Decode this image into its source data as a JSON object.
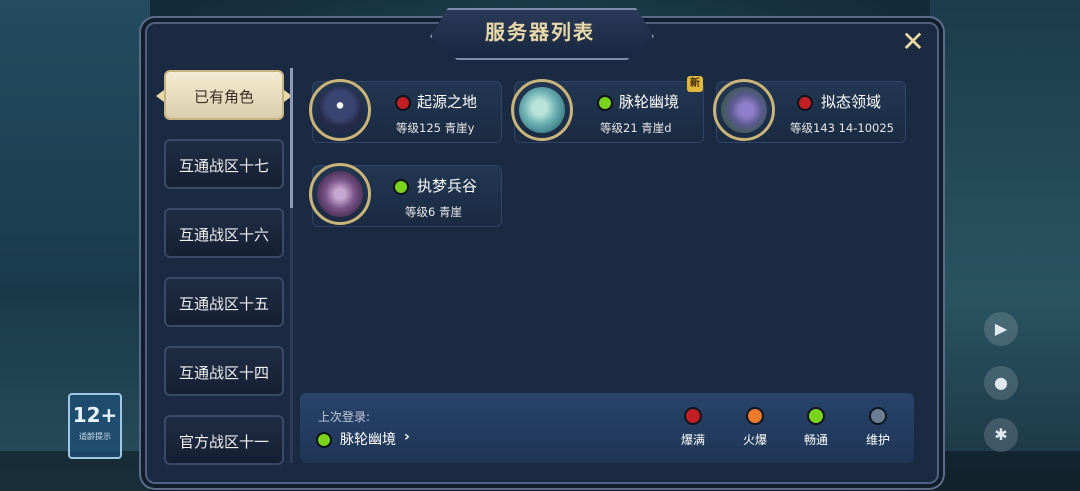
{
  "colors": {
    "full": "#c21f23",
    "hot": "#ef7a2a",
    "smooth": "#7ad21a",
    "maintenance": "#6d7d92",
    "accent": "#e6d9a4"
  },
  "header": {
    "title": "服务器列表",
    "close_icon": "close-icon"
  },
  "sidebar": {
    "items": [
      {
        "label": "已有角色",
        "active": true
      },
      {
        "label": "互通战区十七",
        "active": false
      },
      {
        "label": "互通战区十六",
        "active": false
      },
      {
        "label": "互通战区十五",
        "active": false
      },
      {
        "label": "互通战区十四",
        "active": false
      },
      {
        "label": "官方战区十一",
        "active": false
      }
    ]
  },
  "servers": [
    {
      "name": "起源之地",
      "info": "等级125 青崖y",
      "status": "full",
      "is_new": false
    },
    {
      "name": "脉轮幽境",
      "info": "等级21 青崖d",
      "status": "smooth",
      "is_new": true,
      "new_label": "新"
    },
    {
      "name": "拟态领域",
      "info": "等级143 14-10025",
      "status": "full",
      "is_new": false
    },
    {
      "name": "执梦兵谷",
      "info": "等级6 青崖",
      "status": "smooth",
      "is_new": false
    }
  ],
  "footer": {
    "last_login_label": "上次登录:",
    "last_server": {
      "name": "脉轮幽境",
      "status": "smooth"
    },
    "legend": [
      {
        "label": "爆满",
        "status": "full"
      },
      {
        "label": "火爆",
        "status": "hot"
      },
      {
        "label": "畅通",
        "status": "smooth"
      },
      {
        "label": "维护",
        "status": "maintenance"
      }
    ]
  },
  "age_rating": {
    "value": "12+",
    "sub": "适龄提示"
  }
}
